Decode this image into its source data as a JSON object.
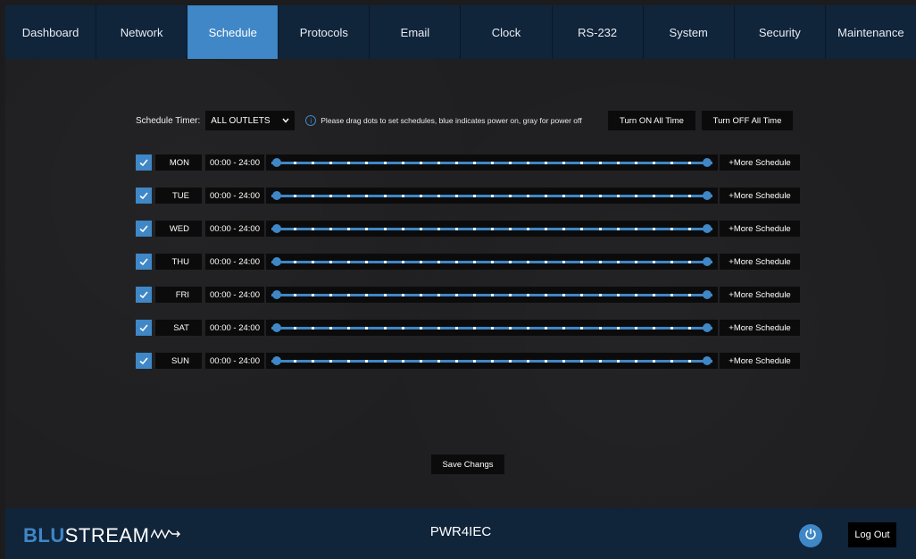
{
  "nav": {
    "items": [
      {
        "label": "Dashboard",
        "active": false
      },
      {
        "label": "Network",
        "active": false
      },
      {
        "label": "Schedule",
        "active": true
      },
      {
        "label": "Protocols",
        "active": false
      },
      {
        "label": "Email",
        "active": false
      },
      {
        "label": "Clock",
        "active": false
      },
      {
        "label": "RS-232",
        "active": false
      },
      {
        "label": "System",
        "active": false
      },
      {
        "label": "Security",
        "active": false
      },
      {
        "label": "Maintenance",
        "active": false
      }
    ]
  },
  "schedule": {
    "timer_label": "Schedule Timer:",
    "timer_value": "ALL OUTLETS",
    "info_icon": "info-icon",
    "info_text": "Please drag dots to set schedules, blue indicates power on, gray for power off",
    "turn_on_label": "Turn ON All Time",
    "turn_off_label": "Turn OFF All Time",
    "more_label": "+More Schedule",
    "save_label": "Save Changs",
    "days": [
      {
        "day": "MON",
        "range": "00:00 - 24:00",
        "checked": true
      },
      {
        "day": "TUE",
        "range": "00:00 - 24:00",
        "checked": true
      },
      {
        "day": "WED",
        "range": "00:00 - 24:00",
        "checked": true
      },
      {
        "day": "THU",
        "range": "00:00 - 24:00",
        "checked": true
      },
      {
        "day": "FRI",
        "range": "00:00 - 24:00",
        "checked": true
      },
      {
        "day": "SAT",
        "range": "00:00 - 24:00",
        "checked": true
      },
      {
        "day": "SUN",
        "range": "00:00 - 24:00",
        "checked": true
      }
    ]
  },
  "footer": {
    "logo_blu": "BLU",
    "logo_stream": "STREAM",
    "device_name": "PWR4IEC",
    "power_icon": "power-icon",
    "logout_label": "Log Out"
  },
  "colors": {
    "accent": "#3f87c6",
    "nav_bg": "#10243a",
    "content_bg": "#1f1f21",
    "control_bg": "#0b0b0c"
  }
}
